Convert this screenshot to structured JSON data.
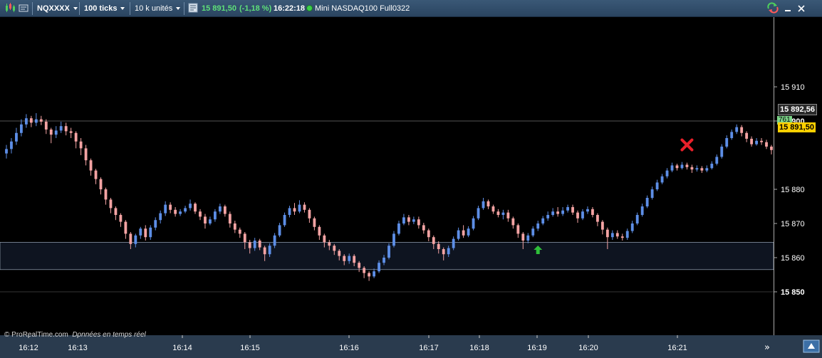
{
  "toolbar": {
    "symbol": "NQXXXX",
    "timeframe": "100 ticks",
    "volume_units": "10 k unités",
    "price": "15 891,50",
    "change": "(-1,18 %)",
    "time": "16:22:18",
    "instrument": "Mini NASDAQ100 Full0322"
  },
  "watermark": {
    "brand": "© ProRealTime.com",
    "note": "Données en temps réel"
  },
  "price_tags": {
    "last": "15 891,50",
    "previous": "15 892,56",
    "count": "761"
  },
  "colors": {
    "up": "#5d8ee6",
    "down": "#f4a3a3",
    "toolbar": "#2f4a66",
    "axis_text": "#ffffff",
    "marker_buy": "#2fbf3a",
    "marker_exit": "#e8202a"
  },
  "chart_data": {
    "type": "candlestick",
    "y_ticks": [
      "15 910",
      "15 900",
      "15 880",
      "15 870",
      "15 860",
      "15 850"
    ],
    "ylim": [
      15845,
      15918
    ],
    "x_ticks": [
      "16:12",
      "16:13",
      "16:14",
      "16:15",
      "16:16",
      "16:17",
      "16:18",
      "16:19",
      "16:20",
      "16:21"
    ],
    "zone": [
      15856.5,
      15864.5
    ],
    "horizontal_line": 15900,
    "candles": [
      [
        15890.5,
        15891.8,
        15889,
        15893
      ],
      [
        15891.8,
        15894,
        15890.5,
        15895
      ],
      [
        15894,
        15896.5,
        15893,
        15898
      ],
      [
        15896.5,
        15899,
        15895.5,
        15900.5
      ],
      [
        15899,
        15900.8,
        15898,
        15902
      ],
      [
        15900.8,
        15899.5,
        15898.2,
        15901.5
      ],
      [
        15899.5,
        15900.5,
        15898.5,
        15902.3
      ],
      [
        15900.5,
        15899.8,
        15898.8,
        15901.5
      ],
      [
        15899.8,
        15897.5,
        15896.2,
        15900.5
      ],
      [
        15897.5,
        15896,
        15893.5,
        15898
      ],
      [
        15896,
        15897.2,
        15895,
        15898.5
      ],
      [
        15897.2,
        15898.5,
        15896.5,
        15899.8
      ],
      [
        15898.5,
        15897,
        15895.8,
        15899.5
      ],
      [
        15897,
        15896.5,
        15895,
        15898
      ],
      [
        15896.5,
        15894,
        15892,
        15897
      ],
      [
        15894,
        15892,
        15890,
        15895
      ],
      [
        15892,
        15888.5,
        15887,
        15893
      ],
      [
        15888.5,
        15885.5,
        15884,
        15889
      ],
      [
        15885.5,
        15883,
        15881.5,
        15886
      ],
      [
        15883,
        15880,
        15878.5,
        15883.5
      ],
      [
        15880,
        15877,
        15875.5,
        15880.5
      ],
      [
        15877,
        15874.5,
        15873,
        15877.5
      ],
      [
        15874.5,
        15872.5,
        15871,
        15875
      ],
      [
        15872.5,
        15870.5,
        15869,
        15873
      ],
      [
        15870.5,
        15867,
        15865.5,
        15871
      ],
      [
        15867,
        15864,
        15862.5,
        15867.5
      ],
      [
        15864,
        15866.5,
        15863,
        15867
      ],
      [
        15866.5,
        15868.5,
        15865.5,
        15869
      ],
      [
        15868.5,
        15866,
        15865,
        15869.5
      ],
      [
        15866,
        15868.8,
        15865.2,
        15869.5
      ],
      [
        15868.8,
        15871,
        15868,
        15871.8
      ],
      [
        15871,
        15873,
        15870,
        15873.8
      ],
      [
        15873,
        15875.5,
        15872.2,
        15876.5
      ],
      [
        15875.5,
        15874,
        15873,
        15876.2
      ],
      [
        15874,
        15872.8,
        15872,
        15874.8
      ],
      [
        15872.8,
        15873.5,
        15872.2,
        15874.2
      ],
      [
        15873.5,
        15874.5,
        15873,
        15875.2
      ],
      [
        15874.5,
        15875.8,
        15873.8,
        15877
      ],
      [
        15875.8,
        15873.5,
        15872.8,
        15876.2
      ],
      [
        15873.5,
        15872,
        15871,
        15874.2
      ],
      [
        15872,
        15870,
        15868.5,
        15872.8
      ],
      [
        15870,
        15871.2,
        15869.5,
        15872
      ],
      [
        15871.2,
        15873.5,
        15870.5,
        15874.2
      ],
      [
        15873.5,
        15875,
        15872.8,
        15875.8
      ],
      [
        15875,
        15872.8,
        15872,
        15875.5
      ],
      [
        15872.8,
        15870,
        15868.8,
        15873.5
      ],
      [
        15870,
        15868.2,
        15867.2,
        15870.8
      ],
      [
        15868.2,
        15867,
        15865.8,
        15868.8
      ],
      [
        15867,
        15864.5,
        15862.5,
        15867.5
      ],
      [
        15864.5,
        15862.8,
        15861.2,
        15865.2
      ],
      [
        15862.8,
        15865,
        15862,
        15865.8
      ],
      [
        15865,
        15863,
        15862.2,
        15865.5
      ],
      [
        15863,
        15861,
        15859,
        15863.5
      ],
      [
        15861,
        15863.5,
        15860.2,
        15864.2
      ],
      [
        15863.5,
        15866.5,
        15862.8,
        15867.2
      ],
      [
        15866.5,
        15869.5,
        15866,
        15870.2
      ],
      [
        15869.5,
        15872.5,
        15869,
        15873.2
      ],
      [
        15872.5,
        15874.5,
        15871.8,
        15875.2
      ],
      [
        15874.5,
        15873.5,
        15872.5,
        15876
      ],
      [
        15873.5,
        15875.5,
        15873,
        15876.8
      ],
      [
        15875.5,
        15874,
        15873.2,
        15876.2
      ],
      [
        15874,
        15871.5,
        15870.2,
        15874.5
      ],
      [
        15871.5,
        15869,
        15868,
        15872
      ],
      [
        15869,
        15866.5,
        15865.2,
        15869.5
      ],
      [
        15866.5,
        15864.5,
        15863,
        15867
      ],
      [
        15864.5,
        15863.5,
        15862.2,
        15865.2
      ],
      [
        15863.5,
        15862,
        15860.8,
        15864
      ],
      [
        15862,
        15860.5,
        15859.2,
        15862.5
      ],
      [
        15860.5,
        15859,
        15857.8,
        15861
      ],
      [
        15859,
        15860.5,
        15858.2,
        15861.2
      ],
      [
        15860.5,
        15858.5,
        15857.5,
        15861
      ],
      [
        15858.5,
        15857,
        15855.8,
        15859
      ],
      [
        15857,
        15855.5,
        15854,
        15857.5
      ],
      [
        15855.5,
        15854.5,
        15853.2,
        15856
      ],
      [
        15854.5,
        15856,
        15854,
        15856.8
      ],
      [
        15856,
        15858.5,
        15855.5,
        15859.2
      ],
      [
        15858.5,
        15860,
        15857.8,
        15860.8
      ],
      [
        15860,
        15863.5,
        15859.5,
        15864.2
      ],
      [
        15863.5,
        15867,
        15863,
        15867.8
      ],
      [
        15867,
        15870,
        15866.5,
        15870.8
      ],
      [
        15870,
        15871.8,
        15869.5,
        15872.8
      ],
      [
        15871.8,
        15870.5,
        15869.5,
        15872.5
      ],
      [
        15870.5,
        15871.2,
        15869.8,
        15872
      ],
      [
        15871.2,
        15869.5,
        15868.5,
        15872
      ],
      [
        15869.5,
        15868,
        15867,
        15870.2
      ],
      [
        15868,
        15866,
        15864.8,
        15868.5
      ],
      [
        15866,
        15864,
        15862.5,
        15866.5
      ],
      [
        15864,
        15862.5,
        15861.2,
        15864.8
      ],
      [
        15862.5,
        15861,
        15859.2,
        15863
      ],
      [
        15861,
        15862.8,
        15860.2,
        15863.5
      ],
      [
        15862.8,
        15865.5,
        15862.2,
        15866.2
      ],
      [
        15865.5,
        15868,
        15865,
        15868.8
      ],
      [
        15868,
        15866.5,
        15865.8,
        15869.5
      ],
      [
        15866.5,
        15868.5,
        15866,
        15869.2
      ],
      [
        15868.5,
        15871.5,
        15868,
        15872.2
      ],
      [
        15871.5,
        15874.5,
        15871,
        15875.2
      ],
      [
        15874.5,
        15876.5,
        15874,
        15877.5
      ],
      [
        15876.5,
        15875,
        15874.2,
        15877
      ],
      [
        15875,
        15873.5,
        15872.8,
        15875.5
      ],
      [
        15873.5,
        15872.5,
        15871.8,
        15874.2
      ],
      [
        15872.5,
        15873.2,
        15871.2,
        15874
      ],
      [
        15873.2,
        15871.5,
        15870.5,
        15874
      ],
      [
        15871.5,
        15869.5,
        15868.5,
        15872
      ],
      [
        15869.5,
        15867,
        15865.8,
        15870
      ],
      [
        15867,
        15865,
        15862.5,
        15867.5
      ],
      [
        15865,
        15866.5,
        15864.2,
        15867.2
      ],
      [
        15866.5,
        15868.5,
        15866,
        15869.2
      ],
      [
        15868.5,
        15870,
        15867.8,
        15870.8
      ],
      [
        15870,
        15871.5,
        15869.5,
        15872.2
      ],
      [
        15871.5,
        15872.5,
        15870.8,
        15873.5
      ],
      [
        15872.5,
        15873.5,
        15872,
        15874.5
      ],
      [
        15873.5,
        15872.8,
        15872,
        15874.8
      ],
      [
        15872.8,
        15873.8,
        15872.2,
        15874.8
      ],
      [
        15873.8,
        15874.8,
        15873.2,
        15875.5
      ],
      [
        15874.8,
        15873.2,
        15872.5,
        15875.5
      ],
      [
        15873.2,
        15871.5,
        15870.2,
        15873.8
      ],
      [
        15871.5,
        15873.5,
        15871,
        15874.2
      ],
      [
        15873.5,
        15874.2,
        15872.8,
        15875
      ],
      [
        15874.2,
        15872.5,
        15871.8,
        15874.8
      ],
      [
        15872.5,
        15870.5,
        15869.2,
        15873
      ],
      [
        15870.5,
        15868.2,
        15866.8,
        15871
      ],
      [
        15868.2,
        15866,
        15862.5,
        15868.8
      ],
      [
        15866,
        15867.2,
        15865.2,
        15868
      ],
      [
        15867.2,
        15866.2,
        15865.5,
        15868
      ],
      [
        15866.2,
        15865.8,
        15865,
        15867
      ],
      [
        15865.8,
        15867.8,
        15865.2,
        15868.5
      ],
      [
        15867.8,
        15870,
        15867.2,
        15870.8
      ],
      [
        15870,
        15872.5,
        15869.5,
        15873.2
      ],
      [
        15872.5,
        15875,
        15872,
        15875.8
      ],
      [
        15875,
        15877.5,
        15874.5,
        15878.2
      ],
      [
        15877.5,
        15880,
        15877,
        15880.8
      ],
      [
        15880,
        15882,
        15879.5,
        15882.8
      ],
      [
        15882,
        15883.8,
        15881.5,
        15884.5
      ],
      [
        15883.8,
        15885.5,
        15883.2,
        15886.2
      ],
      [
        15885.5,
        15887,
        15885,
        15887.8
      ],
      [
        15887,
        15886.2,
        15885.5,
        15887.5
      ],
      [
        15886.2,
        15887.2,
        15885.8,
        15888
      ],
      [
        15887.2,
        15886.5,
        15885.8,
        15887.8
      ],
      [
        15886.5,
        15885.8,
        15884.8,
        15887.2
      ],
      [
        15885.8,
        15886.2,
        15885.2,
        15887
      ],
      [
        15886.2,
        15885.5,
        15884.8,
        15886.8
      ],
      [
        15885.5,
        15886.2,
        15885,
        15887
      ],
      [
        15886.2,
        15887.5,
        15885.8,
        15888.2
      ],
      [
        15887.5,
        15889.5,
        15887,
        15890.2
      ],
      [
        15889.5,
        15892.5,
        15889,
        15893.2
      ],
      [
        15892.5,
        15895,
        15892,
        15895.8
      ],
      [
        15895,
        15896.8,
        15894.5,
        15897.5
      ],
      [
        15896.8,
        15898.2,
        15896.2,
        15899
      ],
      [
        15898.2,
        15896.5,
        15895.5,
        15898.8
      ],
      [
        15896.5,
        15894.8,
        15893.8,
        15897
      ],
      [
        15894.8,
        15893.2,
        15892.5,
        15895.5
      ],
      [
        15893.2,
        15894.2,
        15892.8,
        15895
      ],
      [
        15894.2,
        15893.8,
        15893,
        15895
      ],
      [
        15893.8,
        15892.5,
        15891.8,
        15894.5
      ],
      [
        15892.5,
        15891.5,
        15890.2,
        15893
      ]
    ],
    "markers": [
      {
        "type": "buy-arrow",
        "index": 107,
        "price": 15862.3
      },
      {
        "type": "exit-cross",
        "index": 137,
        "price": 15893
      }
    ]
  }
}
